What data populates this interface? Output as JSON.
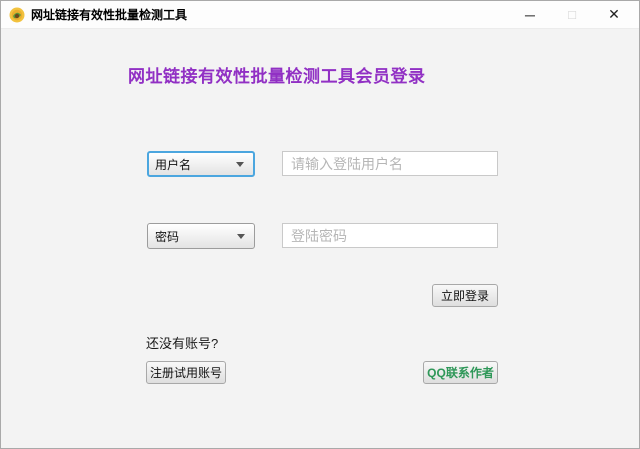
{
  "window": {
    "title": "网址链接有效性批量检测工具",
    "icons": {
      "app_icon": "flower-logo-icon",
      "minimize": "─",
      "maximize": "□",
      "close": "✕"
    }
  },
  "form": {
    "heading": "网址链接有效性批量检测工具会员登录",
    "username_row": {
      "dropdown_value": "用户名",
      "input_value": "",
      "input_placeholder": "请输入登陆用户名"
    },
    "password_row": {
      "dropdown_value": "密码",
      "input_value": "",
      "input_placeholder": "登陆密码"
    },
    "login_button_label": "立即登录",
    "no_account_text": "还没有账号?",
    "register_button_label": "注册试用账号",
    "qq_button_label": "QQ联系作者"
  },
  "colors": {
    "heading-purple": "#9130C4",
    "qq-green": "#2E9758",
    "focus-blue": "#4BA6DF"
  }
}
